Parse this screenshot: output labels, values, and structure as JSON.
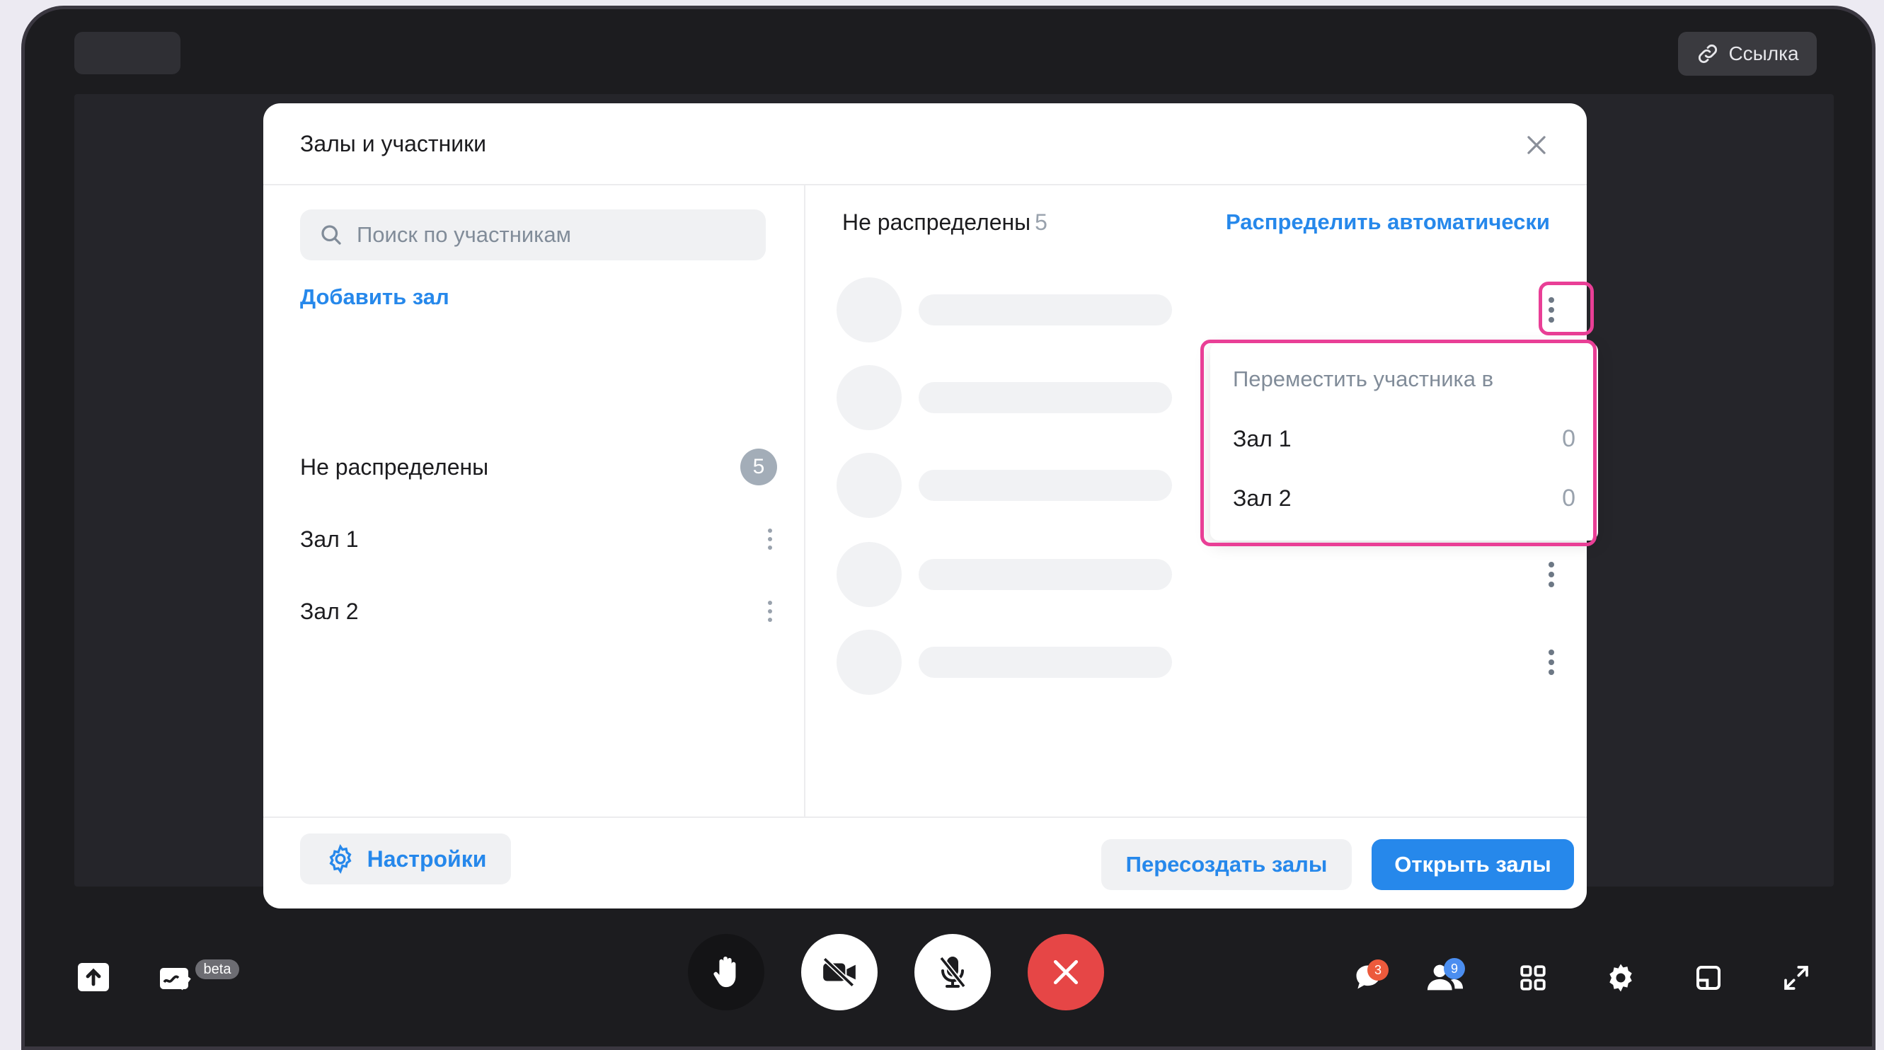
{
  "topbar": {
    "link_label": "Ссылка"
  },
  "modal": {
    "title": "Залы и участники",
    "search_placeholder": "Поиск по участникам",
    "add_hall": "Добавить зал",
    "rooms": [
      {
        "label": "Не распределены",
        "count": "5"
      },
      {
        "label": "Зал 1"
      },
      {
        "label": "Зал 2"
      }
    ],
    "right": {
      "title": "Не распределены",
      "count": "5",
      "auto_distribute": "Распределить автоматически"
    },
    "move_menu": {
      "header": "Переместить участника в",
      "items": [
        {
          "label": "Зал 1",
          "count": "0"
        },
        {
          "label": "Зал 2",
          "count": "0"
        }
      ]
    },
    "footer": {
      "settings": "Настройки",
      "recreate": "Пересоздать залы",
      "open": "Открыть залы"
    }
  },
  "toolbar": {
    "beta": "beta",
    "chat_badge": "3",
    "participants_badge": "9"
  },
  "colors": {
    "accent": "#2688eb",
    "highlight": "#e93f96",
    "end_call": "#e64646"
  }
}
